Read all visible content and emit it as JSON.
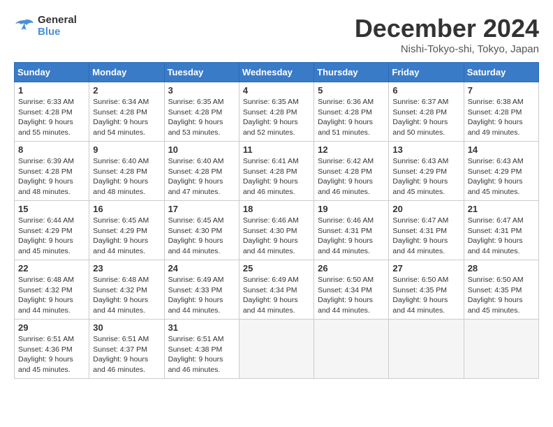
{
  "header": {
    "logo_line1": "General",
    "logo_line2": "Blue",
    "month": "December 2024",
    "location": "Nishi-Tokyo-shi, Tokyo, Japan"
  },
  "weekdays": [
    "Sunday",
    "Monday",
    "Tuesday",
    "Wednesday",
    "Thursday",
    "Friday",
    "Saturday"
  ],
  "weeks": [
    [
      {
        "day": 1,
        "sunrise": "6:33 AM",
        "sunset": "4:28 PM",
        "daylight": "9 hours and 55 minutes."
      },
      {
        "day": 2,
        "sunrise": "6:34 AM",
        "sunset": "4:28 PM",
        "daylight": "9 hours and 54 minutes."
      },
      {
        "day": 3,
        "sunrise": "6:35 AM",
        "sunset": "4:28 PM",
        "daylight": "9 hours and 53 minutes."
      },
      {
        "day": 4,
        "sunrise": "6:35 AM",
        "sunset": "4:28 PM",
        "daylight": "9 hours and 52 minutes."
      },
      {
        "day": 5,
        "sunrise": "6:36 AM",
        "sunset": "4:28 PM",
        "daylight": "9 hours and 51 minutes."
      },
      {
        "day": 6,
        "sunrise": "6:37 AM",
        "sunset": "4:28 PM",
        "daylight": "9 hours and 50 minutes."
      },
      {
        "day": 7,
        "sunrise": "6:38 AM",
        "sunset": "4:28 PM",
        "daylight": "9 hours and 49 minutes."
      }
    ],
    [
      {
        "day": 8,
        "sunrise": "6:39 AM",
        "sunset": "4:28 PM",
        "daylight": "9 hours and 48 minutes."
      },
      {
        "day": 9,
        "sunrise": "6:40 AM",
        "sunset": "4:28 PM",
        "daylight": "9 hours and 48 minutes."
      },
      {
        "day": 10,
        "sunrise": "6:40 AM",
        "sunset": "4:28 PM",
        "daylight": "9 hours and 47 minutes."
      },
      {
        "day": 11,
        "sunrise": "6:41 AM",
        "sunset": "4:28 PM",
        "daylight": "9 hours and 46 minutes."
      },
      {
        "day": 12,
        "sunrise": "6:42 AM",
        "sunset": "4:28 PM",
        "daylight": "9 hours and 46 minutes."
      },
      {
        "day": 13,
        "sunrise": "6:43 AM",
        "sunset": "4:29 PM",
        "daylight": "9 hours and 45 minutes."
      },
      {
        "day": 14,
        "sunrise": "6:43 AM",
        "sunset": "4:29 PM",
        "daylight": "9 hours and 45 minutes."
      }
    ],
    [
      {
        "day": 15,
        "sunrise": "6:44 AM",
        "sunset": "4:29 PM",
        "daylight": "9 hours and 45 minutes."
      },
      {
        "day": 16,
        "sunrise": "6:45 AM",
        "sunset": "4:29 PM",
        "daylight": "9 hours and 44 minutes."
      },
      {
        "day": 17,
        "sunrise": "6:45 AM",
        "sunset": "4:30 PM",
        "daylight": "9 hours and 44 minutes."
      },
      {
        "day": 18,
        "sunrise": "6:46 AM",
        "sunset": "4:30 PM",
        "daylight": "9 hours and 44 minutes."
      },
      {
        "day": 19,
        "sunrise": "6:46 AM",
        "sunset": "4:31 PM",
        "daylight": "9 hours and 44 minutes."
      },
      {
        "day": 20,
        "sunrise": "6:47 AM",
        "sunset": "4:31 PM",
        "daylight": "9 hours and 44 minutes."
      },
      {
        "day": 21,
        "sunrise": "6:47 AM",
        "sunset": "4:31 PM",
        "daylight": "9 hours and 44 minutes."
      }
    ],
    [
      {
        "day": 22,
        "sunrise": "6:48 AM",
        "sunset": "4:32 PM",
        "daylight": "9 hours and 44 minutes."
      },
      {
        "day": 23,
        "sunrise": "6:48 AM",
        "sunset": "4:32 PM",
        "daylight": "9 hours and 44 minutes."
      },
      {
        "day": 24,
        "sunrise": "6:49 AM",
        "sunset": "4:33 PM",
        "daylight": "9 hours and 44 minutes."
      },
      {
        "day": 25,
        "sunrise": "6:49 AM",
        "sunset": "4:34 PM",
        "daylight": "9 hours and 44 minutes."
      },
      {
        "day": 26,
        "sunrise": "6:50 AM",
        "sunset": "4:34 PM",
        "daylight": "9 hours and 44 minutes."
      },
      {
        "day": 27,
        "sunrise": "6:50 AM",
        "sunset": "4:35 PM",
        "daylight": "9 hours and 44 minutes."
      },
      {
        "day": 28,
        "sunrise": "6:50 AM",
        "sunset": "4:35 PM",
        "daylight": "9 hours and 45 minutes."
      }
    ],
    [
      {
        "day": 29,
        "sunrise": "6:51 AM",
        "sunset": "4:36 PM",
        "daylight": "9 hours and 45 minutes."
      },
      {
        "day": 30,
        "sunrise": "6:51 AM",
        "sunset": "4:37 PM",
        "daylight": "9 hours and 46 minutes."
      },
      {
        "day": 31,
        "sunrise": "6:51 AM",
        "sunset": "4:38 PM",
        "daylight": "9 hours and 46 minutes."
      },
      null,
      null,
      null,
      null
    ]
  ]
}
